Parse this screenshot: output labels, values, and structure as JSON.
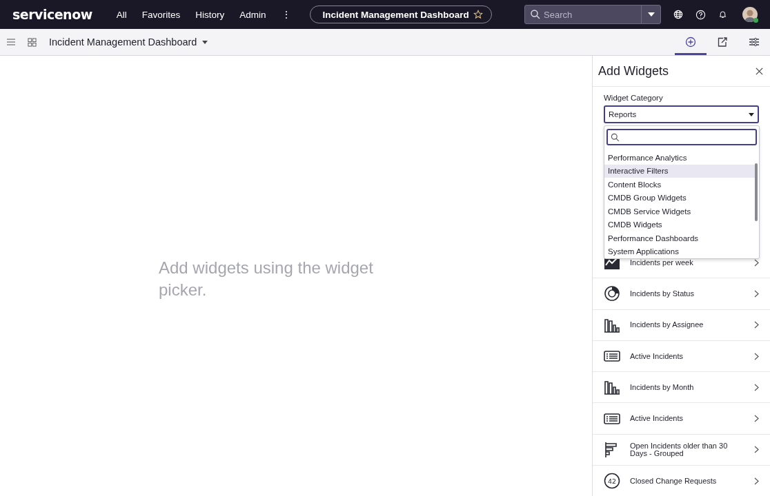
{
  "top_nav": {
    "logo": "servicenow",
    "menu": [
      "All",
      "Favorites",
      "History",
      "Admin"
    ],
    "more": "⋮",
    "dashboard_pill": {
      "title": "Incident Management Dashboard",
      "favorite": false
    },
    "search": {
      "placeholder": "Search"
    },
    "avatar": {
      "online": true
    }
  },
  "toolbar": {
    "title": "Incident Management Dashboard",
    "actions": [
      {
        "kind": "add",
        "selected": true
      },
      {
        "kind": "share",
        "selected": false
      },
      {
        "kind": "settings",
        "selected": false
      }
    ]
  },
  "canvas": {
    "empty_message": "Add widgets using the widget picker."
  },
  "panel": {
    "title": "Add Widgets",
    "category": {
      "label": "Widget Category",
      "value": "Reports"
    },
    "dropdown": {
      "options": [
        {
          "label": "Performance Analytics",
          "selected": false
        },
        {
          "label": "Interactive Filters",
          "selected": true
        },
        {
          "label": "Content Blocks",
          "selected": false
        },
        {
          "label": "CMDB Group Widgets",
          "selected": false
        },
        {
          "label": "CMDB Service Widgets",
          "selected": false
        },
        {
          "label": "CMDB Widgets",
          "selected": false
        },
        {
          "label": "Performance Dashboards",
          "selected": false
        },
        {
          "label": "System Applications",
          "selected": false
        }
      ]
    },
    "widgets": [
      {
        "kind": "line",
        "label": "Incidents per week"
      },
      {
        "kind": "donut",
        "label": "Incidents by Status"
      },
      {
        "kind": "bar",
        "label": "Incidents by Assignee"
      },
      {
        "kind": "list",
        "label": "Active Incidents"
      },
      {
        "kind": "bar",
        "label": "Incidents by Month"
      },
      {
        "kind": "list",
        "label": "Active Incidents"
      },
      {
        "kind": "hbar",
        "label": "Open Incidents older than 30 Days - Grouped"
      },
      {
        "kind": "number",
        "label": "Closed Change Requests",
        "value": "42"
      }
    ]
  }
}
